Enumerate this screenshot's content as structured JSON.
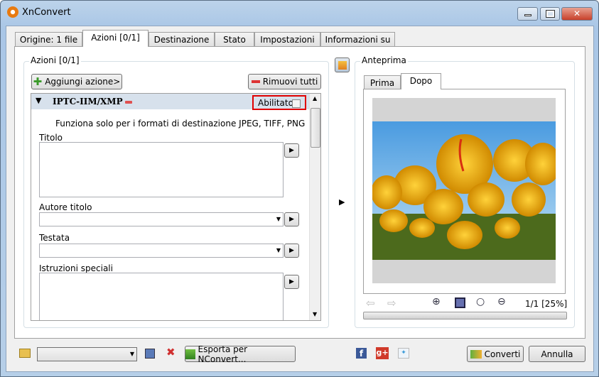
{
  "window": {
    "title": "XnConvert"
  },
  "tabs": [
    {
      "label": "Origine: 1 file"
    },
    {
      "label": "Azioni [0/1]"
    },
    {
      "label": "Destinazione"
    },
    {
      "label": "Stato"
    },
    {
      "label": "Impostazioni"
    },
    {
      "label": "Informazioni su"
    }
  ],
  "actions": {
    "group_title": "Azioni [0/1]",
    "add_button": "Aggiungi azione>",
    "remove_all_button": "Rimuovi tutti",
    "item": {
      "name": "IPTC-IIM/XMP",
      "enabled_label": "Abilitato",
      "enabled": false,
      "note": "Funziona solo per i formati di destinazione JPEG, TIFF, PNG",
      "fields": {
        "title": "Titolo",
        "title_author": "Autore titolo",
        "headline": "Testata",
        "special_instructions": "Istruzioni speciali"
      }
    }
  },
  "preview": {
    "group_title": "Anteprima",
    "tabs": [
      {
        "label": "Prima"
      },
      {
        "label": "Dopo"
      }
    ],
    "page_info": "1/1 [25%]"
  },
  "bottom": {
    "export_button": "Esporta per NConvert...",
    "convert_button": "Converti",
    "cancel_button": "Annulla"
  }
}
